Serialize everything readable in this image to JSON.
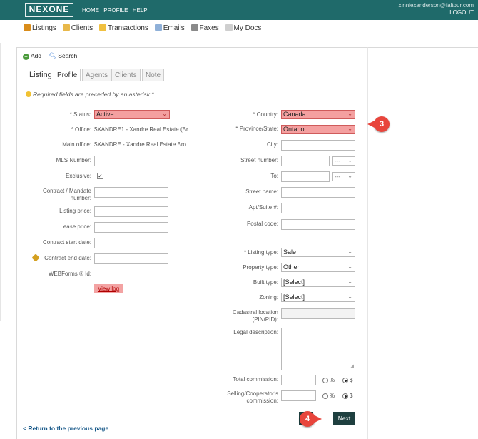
{
  "header": {
    "logo": "NEXONE",
    "nav": [
      "HOME",
      "PROFILE",
      "HELP"
    ],
    "user_email": "xinniexanderson@faltour.com",
    "logout": "LOGOUT"
  },
  "modules": [
    "Listings",
    "Clients",
    "Transactions",
    "Emails",
    "Faxes",
    "My Docs"
  ],
  "actions": {
    "add": "Add",
    "search": "Search"
  },
  "tabs": [
    "Listing",
    "Profile",
    "Agents",
    "Clients",
    "Note"
  ],
  "required_note": "Required fields are preceded by an asterisk *",
  "left_form": {
    "status": {
      "label": "* Status:",
      "value": "Active"
    },
    "office": {
      "label": "* Office:",
      "value": "$XANDRE1 - Xandre Real Estate (Br..."
    },
    "main_office": {
      "label": "Main office:",
      "value": "$XANDRE - Xandre Real Estate Bro..."
    },
    "mls_number": {
      "label": "MLS Number:"
    },
    "exclusive": {
      "label": "Exclusive:",
      "checked": "✓"
    },
    "contract_mandate": {
      "label1": "Contract / Mandate",
      "label2": "number:"
    },
    "listing_price": {
      "label": "Listing price:"
    },
    "lease_price": {
      "label": "Lease price:"
    },
    "contract_start": {
      "label": "Contract start date:"
    },
    "contract_end": {
      "label": "Contract end date:"
    },
    "webforms": {
      "label": "WEBForms ® Id:"
    },
    "view_log": "View log"
  },
  "right_form": {
    "country": {
      "label": "* Country:",
      "value": "Canada"
    },
    "province": {
      "label": "* Province/State:",
      "value": "Ontario"
    },
    "city": {
      "label": "City:"
    },
    "street_number": {
      "label": "Street number:",
      "select": "---"
    },
    "to": {
      "label": "To:",
      "select": "---"
    },
    "street_name": {
      "label": "Street name:"
    },
    "apt_suite": {
      "label": "Apt/Suite #:"
    },
    "postal_code": {
      "label": "Postal code:"
    },
    "listing_type": {
      "label": "* Listing type:",
      "value": "Sale"
    },
    "property_type": {
      "label": "Property type:",
      "value": "Other"
    },
    "built_type": {
      "label": "Built type:",
      "value": "[Select]"
    },
    "zoning": {
      "label": "Zoning:",
      "value": "[Select]"
    },
    "cadastral": {
      "label1": "Cadastral location",
      "label2": "(PIN/PID):"
    },
    "legal_description": {
      "label": "Legal description:"
    },
    "total_commission": {
      "label": "Total commission:",
      "pct": "%",
      "dollar": "$"
    },
    "selling_commission": {
      "label1": "Selling/Cooperator's",
      "label2": "commission:",
      "pct": "%",
      "dollar": "$"
    }
  },
  "buttons": {
    "next": "Next",
    "back": "< Return to the previous page"
  },
  "callouts": {
    "c3": "3",
    "c4": "4"
  },
  "colors": {
    "header": "#1f6a6a",
    "error_field": "#f4a0a0",
    "callout": "#e8453c",
    "button": "#1e3f3f"
  }
}
